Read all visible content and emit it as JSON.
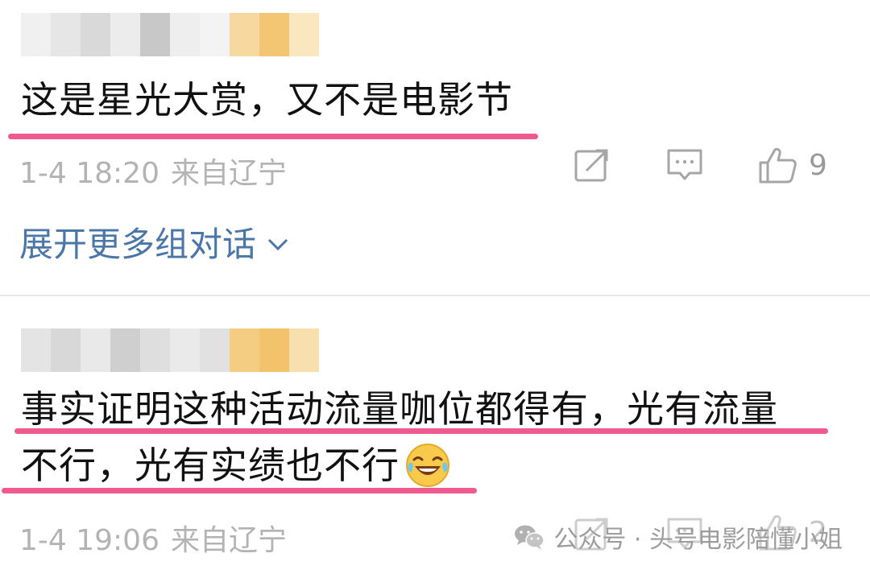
{
  "comments": [
    {
      "text_lines": [
        "这是星光大赏，又不是电影节"
      ],
      "date": "1-4 18:20",
      "location": "来自辽宁",
      "like_count": "9"
    },
    {
      "text_lines": [
        "事实证明这种活动流量咖位都得有，光有流量",
        "不行，光有实绩也不行"
      ],
      "date": "1-4 19:06",
      "location": "来自辽宁",
      "like_count": "2"
    }
  ],
  "expand_label": "展开更多组对话",
  "watermark": "公众号 · 头号电影陪懂小姐",
  "icons": {
    "share": "share-icon",
    "comment": "comment-icon",
    "like": "thumbs-up-icon",
    "expand": "chevron-down-icon",
    "emoji": "laughing-tears-emoji",
    "watermark": "wechat-icon"
  },
  "colors": {
    "underline": "#ef5b8e",
    "link": "#4a76a8",
    "meta": "#b3b3b3"
  }
}
